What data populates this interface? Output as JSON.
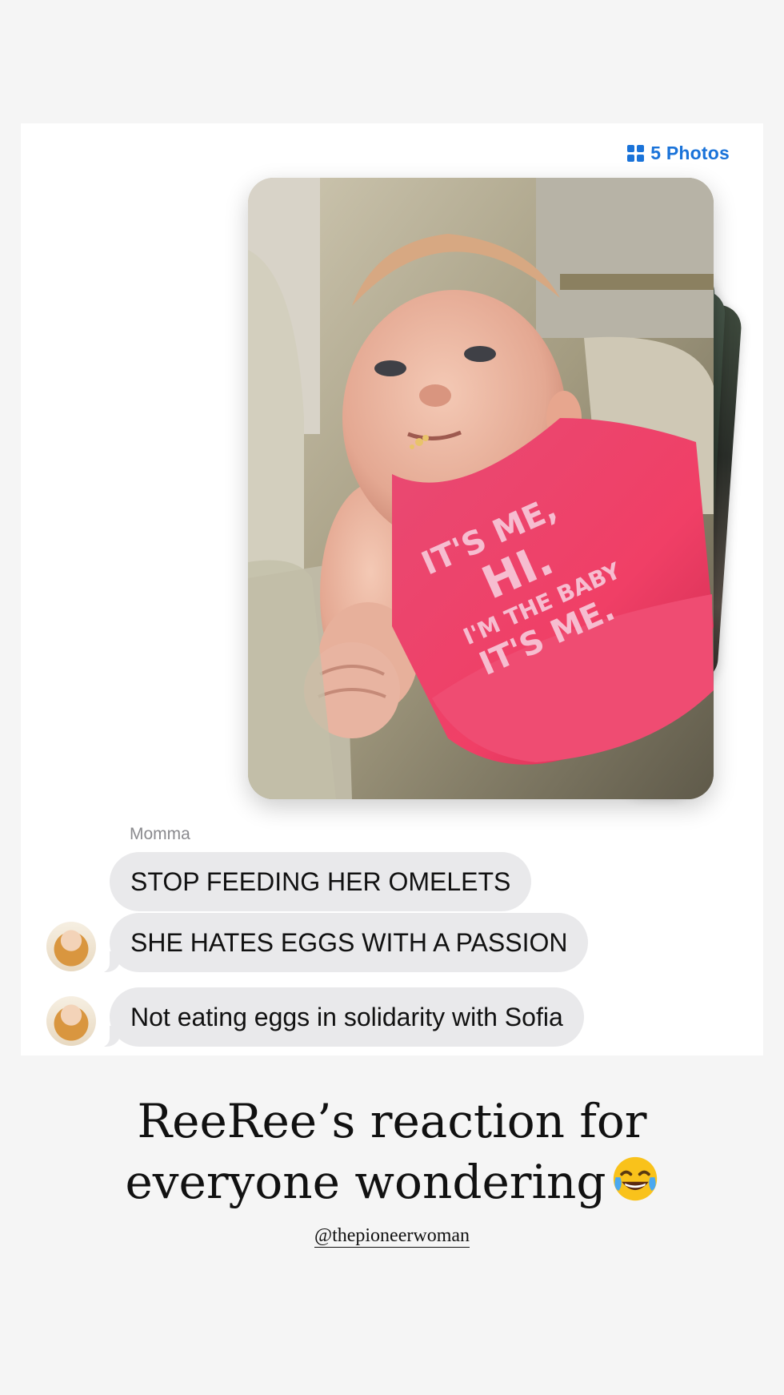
{
  "photos_badge": {
    "label": "5 Photos",
    "icon": "grid-icon",
    "color": "#1a73d9"
  },
  "photo": {
    "bib_text": [
      "IT'S ME,",
      "HI.",
      "I'M THE BABY",
      "IT'S ME."
    ],
    "bib_color": "#e8456e"
  },
  "messages": {
    "sender": "Momma",
    "items": [
      {
        "text": "STOP FEEDING HER OMELETS",
        "avatar": false
      },
      {
        "text": "SHE HATES EGGS WITH A PASSION",
        "avatar": true
      },
      {
        "text": "Not eating eggs in solidarity with Sofia",
        "avatar": true
      }
    ],
    "bubble_color": "#e9e9eb"
  },
  "caption": {
    "line1": "ReeRee’s reaction for",
    "line2": "everyone wondering",
    "emoji": "face-with-tears-of-joy"
  },
  "handle": "@thepioneerwoman"
}
